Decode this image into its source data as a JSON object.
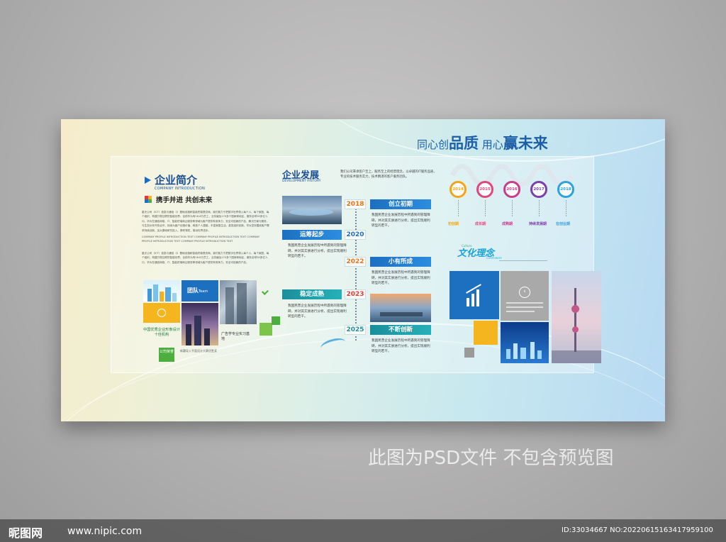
{
  "slogan": {
    "part1": "同心创",
    "part2": "品质",
    "part3": " 用心",
    "part4": "赢未来"
  },
  "intro": {
    "title": "企业简介",
    "subtitle": "COMPANY INTRODUCTION",
    "motto": "携手并进 共创未来",
    "para1": "星光公司（ICT）信息与通信（I）基础设施和智能终端提供商，我们致力于把数字世界带入每个人、每个家庭、每个组织，构建万物互联的智能世界。目前华为有18.8万员工，业务遍及170多个国家和地区，服务全球30多亿人口。华为在通信网络、IT、智能终端和云服务等领域为客户提供有竞争力、安全可信赖的产品、解决方案与服务，与生态伙伴开放合作，持续为客户创造价值，释放个人潜能，丰富家庭生活，激发组织创新。华为坚持围绕客户需求持续创新，加大基础研究投入，厚积薄发，推动世界进步。",
    "para2": "COMPANY PROFILE INTRODUCTION TEXT COMPANY PROFILE INTRODUCTION TEXT COMPANY PROFILE INTRODUCTION TEXT COMPANY PROFILE INTRODUCTION TEXT",
    "para3": "星光公司（ICT）信息与通信（I）基础设施和智能终端提供商，我们致力于把数字世界带入每个人、每个家庭、每个组织，构建万物互联的智能世界。目前华为有18.8万员工，业务遍及170多个国家和地区，服务全球30多亿人口。华为在通信网络、IT、智能终端和云服务等领域为客户提供有竞争力、安全可信赖的产品。",
    "team_label": "团队",
    "team_en": "Team",
    "award": "中国优秀企业形象设计十佳机构",
    "ad_base": "广告学专业实习基地",
    "badge": "公司荣誉",
    "honor_text": "新疆导入平面设计大赛优胜奖"
  },
  "development": {
    "title": "企业发展",
    "subtitle": "DEVELOPMENT HISTORY",
    "desc": "我们公司秉承客户至上，服务至上的经营理念，以卓越的IT服务品质，专业的技术服务实力，技术精湛的客户服务团队。",
    "milestones": [
      {
        "year": "2018",
        "stage": "创立初期",
        "desc": "我国民营企业发展历程中所遇到的管理障碍，并对其实质进行分析，提出实现顺利转型的若干。"
      },
      {
        "year": "2020",
        "stage": "运筹起步",
        "desc": "我国民营企业发展历程中所遇到的管理障碍，并对其实质进行分析，提出实现顺利转型的若干。"
      },
      {
        "year": "2022",
        "stage": "小有所成",
        "desc": "我国民营企业发展历程中所遇到的管理障碍，并对其实质进行分析，提出实现顺利转型的若干。"
      },
      {
        "year": "2023",
        "stage": "稳定成熟",
        "desc": "我国民营企业发展历程中所遇到的管理障碍，并对其实质进行分析，提出实现顺利转型的若干。"
      },
      {
        "year": "2025",
        "stage": "不断创新",
        "desc": "我国民营企业发展历程中所遇到的管理障碍，并对其实质进行分析，提出实现顺利转型的若干。"
      }
    ]
  },
  "phases": [
    {
      "year": "2014",
      "label": "初创期",
      "color": "#f2a516"
    },
    {
      "year": "2015",
      "label": "成长期",
      "color": "#e0477a"
    },
    {
      "year": "2016",
      "label": "成熟期",
      "color": "#c83c8a"
    },
    {
      "year": "2017",
      "label": "持续发展期",
      "color": "#7b3fa8"
    },
    {
      "year": "2018",
      "label": "在创业期",
      "color": "#2aa3de"
    }
  ],
  "culture": {
    "title": "文化理念",
    "en": "Culture",
    "en2": "CORPORATE"
  },
  "colors": {
    "brand_blue": "#1b4f93",
    "accent_blue": "#1d6fc0",
    "teal": "#1a8f9c",
    "orange": "#e8731a"
  },
  "watermark": "此图为PSD文件 不包含预览图",
  "footer": {
    "logo": "昵图网",
    "url": "www.nipic.com",
    "id": "ID:33034667 NO:20220615163417959100"
  }
}
